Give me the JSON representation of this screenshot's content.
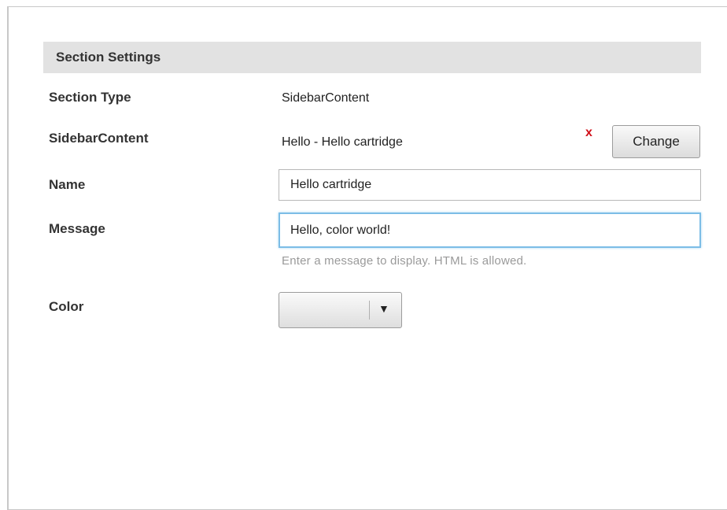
{
  "section": {
    "title": "Section Settings"
  },
  "fields": {
    "section_type": {
      "label": "Section Type",
      "value": "SidebarContent"
    },
    "sidebar_content": {
      "label": "SidebarContent",
      "value": "Hello - Hello cartridge",
      "remove_label": "x",
      "change_label": "Change"
    },
    "name": {
      "label": "Name",
      "value": "Hello cartridge"
    },
    "message": {
      "label": "Message",
      "value": "Hello, color world!",
      "hint": "Enter a message to display. HTML is allowed."
    },
    "color": {
      "label": "Color",
      "value": "",
      "caret": "▼"
    }
  },
  "colors": {
    "header_bg": "#e2e2e2",
    "focus_border": "#7cbde6",
    "remove_red": "#d0101a",
    "hint_text": "#9a9a9a"
  }
}
